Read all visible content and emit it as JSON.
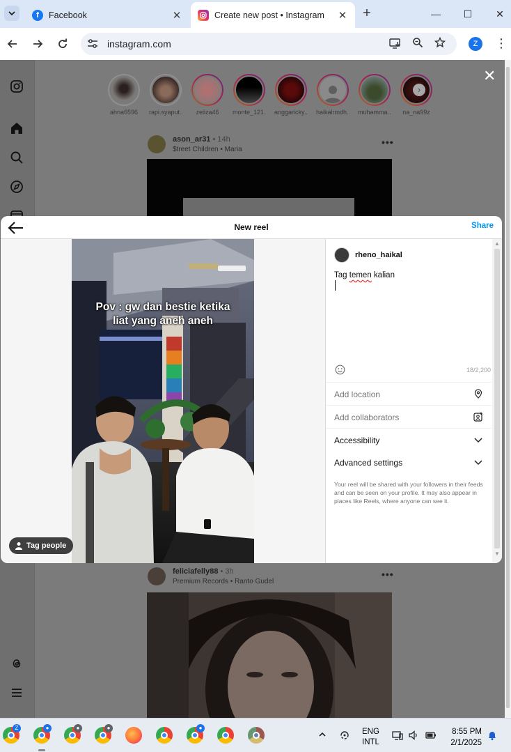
{
  "browser": {
    "tabs": [
      {
        "title": "Facebook",
        "favicon": "facebook-icon",
        "active": false
      },
      {
        "title": "Create new post • Instagram",
        "favicon": "instagram-icon",
        "active": true
      }
    ],
    "new_tab_label": "+",
    "url": "instagram.com",
    "profile_initial": "Z"
  },
  "stories": [
    {
      "user": "ahna6596",
      "seen": true
    },
    {
      "user": "rapi.syaput...",
      "seen": true
    },
    {
      "user": "zeiiza46",
      "seen": false
    },
    {
      "user": "monte_121...",
      "seen": false
    },
    {
      "user": "anggaricky...",
      "seen": false
    },
    {
      "user": "haikalrmdh...",
      "seen": false
    },
    {
      "user": "muhamma...",
      "seen": false
    },
    {
      "user": "na_na99z",
      "seen": false
    }
  ],
  "feed": {
    "post1": {
      "user": "ason_ar31",
      "time": "• 14h",
      "sub": "$treet Children • Maria"
    },
    "post2": {
      "user": "feliciafelly88",
      "time": "• 3h",
      "sub": "Premium Records • Ranto Gudel"
    }
  },
  "modal": {
    "title": "New reel",
    "share_label": "Share",
    "video_overlay_line1": "Pov : gw dan bestie ketika",
    "video_overlay_line2": "liat yang aneh aneh",
    "tag_people_label": "Tag people",
    "author": "rheno_haikal",
    "caption_word1": "Tag",
    "caption_word2": "temen",
    "caption_word3": "kalian",
    "char_count": "18/2,200",
    "add_location": "Add location",
    "add_collaborators": "Add collaborators",
    "accessibility": "Accessibility",
    "advanced_settings": "Advanced settings",
    "share_note": "Your reel will be shared with your followers in their feeds and can be seen on your profile. It may also appear in places like Reels, where anyone can see it."
  },
  "taskbar": {
    "lang_line1": "ENG",
    "lang_line2": "INTL",
    "time": "8:55 PM",
    "date": "2/1/2025"
  },
  "colors": {
    "accent": "#0095f6",
    "browser_frame": "#dbe6f6",
    "overlay": "#7b7b7b"
  }
}
